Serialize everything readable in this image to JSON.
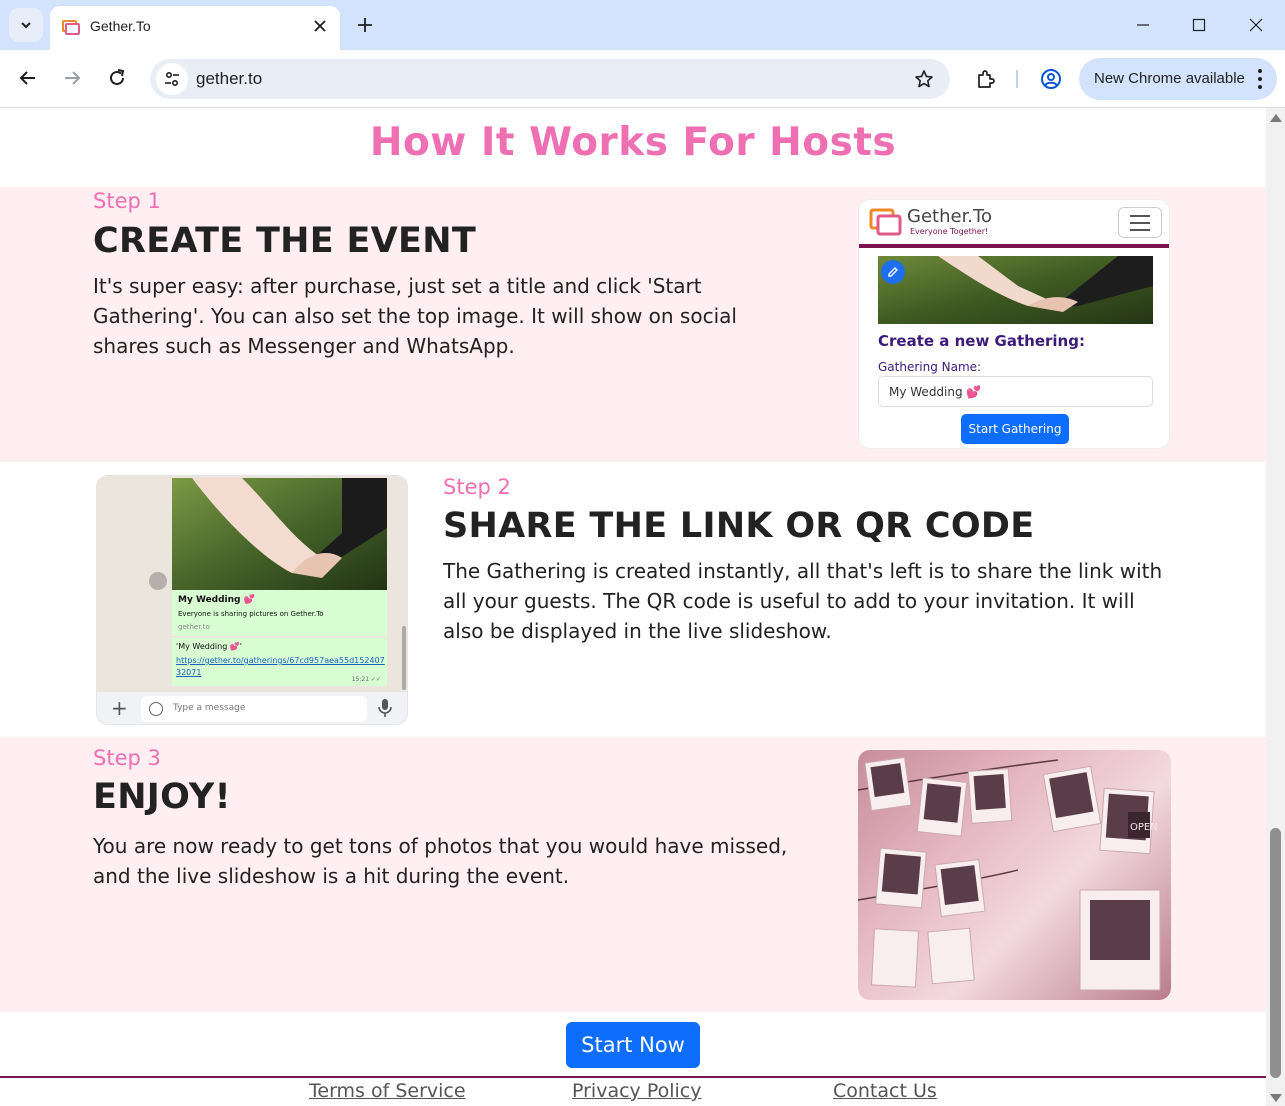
{
  "browser": {
    "tab_title": "Gether.To",
    "url": "gether.to",
    "update_label": "New Chrome available"
  },
  "page": {
    "title": "How It Works For Hosts",
    "steps": [
      {
        "label": "Step 1",
        "heading": "CREATE THE EVENT",
        "text": "It's super easy: after purchase, just set a title and click 'Start Gathering'. You can also set the top image. It will show on social shares such as Messenger and WhatsApp."
      },
      {
        "label": "Step 2",
        "heading": "SHARE THE LINK OR QR CODE",
        "text": "The Gathering is created instantly, all that's left is to share the link with all your guests. The QR code is useful to add to your invitation. It will also be displayed in the live slideshow."
      },
      {
        "label": "Step 3",
        "heading": "ENJOY!",
        "text": "You are now ready to get tons of photos that you would have missed, and the live slideshow is a hit during the event."
      }
    ],
    "step1_mock": {
      "logo_name": "Gether.To",
      "logo_tagline": "Everyone  Together!",
      "create_title": "Create a new Gathering:",
      "name_label": "Gathering Name:",
      "name_value": "My Wedding 💕",
      "button": "Start Gathering"
    },
    "step2_mock": {
      "msg_title": "My Wedding 💕",
      "msg_sub": "Everyone is sharing pictures on Gether.To",
      "msg_domain": "gether.to",
      "msg2_title": "'My Wedding 💕'",
      "msg2_link": "https://gether.to/gatherings/67cd957aea55d15240732071",
      "msg2_time": "15:21 ✓✓",
      "placeholder": "Type a message"
    },
    "step3_image_text": "OPEN",
    "cta": "Start Now",
    "footer": {
      "terms": "Terms of Service",
      "privacy": "Privacy Policy",
      "contact": "Contact Us"
    }
  },
  "colors": {
    "accent_pink": "#ef6fb3",
    "band_pink": "#ffeef2",
    "brand_maroon": "#7b1350",
    "primary_blue": "#0d6efd"
  }
}
